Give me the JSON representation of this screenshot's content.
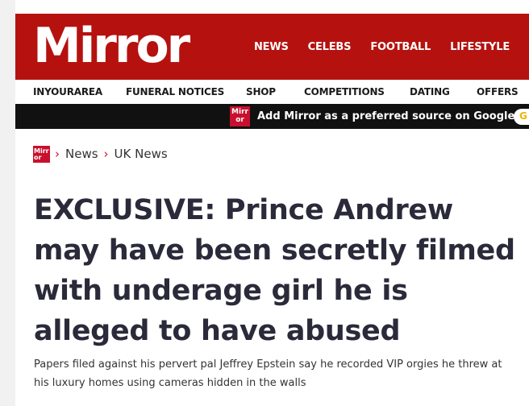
{
  "masthead": {
    "logo_text": "Mirror",
    "brand_color": "#b5120f",
    "nav": [
      "NEWS",
      "CELEBS",
      "FOOTBALL",
      "LIFESTYLE"
    ]
  },
  "sub_nav": [
    "INYOURAREA",
    "FUNERAL NOTICES",
    "SHOP",
    "COMPETITIONS",
    "DATING",
    "OFFERS"
  ],
  "banner": {
    "logo_text": "Mirr or",
    "text": "Add Mirror as a preferred source on Google",
    "pill_icon": "google-icon"
  },
  "breadcrumb": {
    "logo_text": "Mirr or",
    "items": [
      "News",
      "UK News"
    ]
  },
  "article": {
    "headline": "EXCLUSIVE: Prince Andrew may have been secretly filmed with underage girl he is alleged to have abused",
    "standfirst": "Papers filed against his pervert pal Jeffrey Epstein say he recorded VIP orgies he threw at his luxury homes using cameras hidden in the walls"
  }
}
